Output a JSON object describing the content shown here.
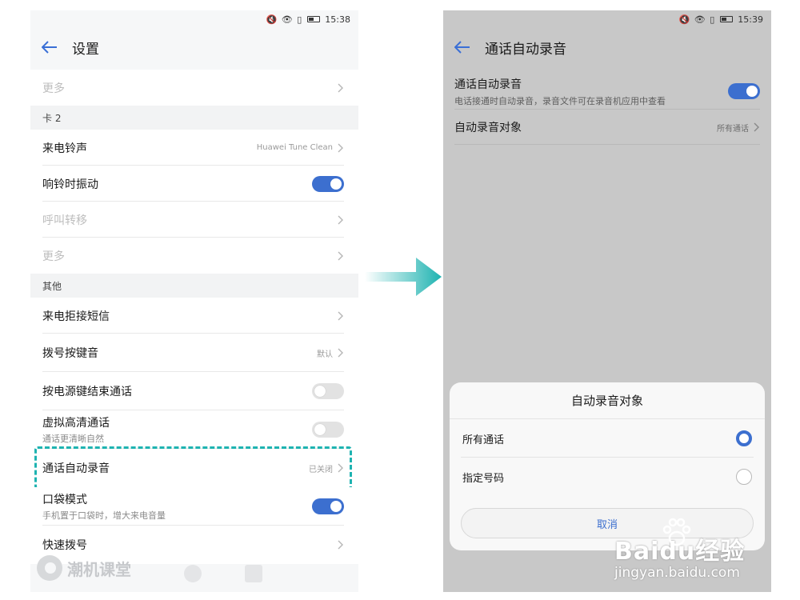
{
  "left": {
    "status": {
      "time": "15:38",
      "icons": "🔇 👁 ▯"
    },
    "title": "设置",
    "rows": [
      {
        "label": "更多",
        "disabled": true
      },
      {
        "section": "卡 2"
      },
      {
        "label": "来电铃声",
        "value": "Huawei Tune Clean"
      },
      {
        "label": "响铃时振动",
        "toggle": "on"
      },
      {
        "label": "呼叫转移",
        "disabled": true
      },
      {
        "label": "更多",
        "disabled": true
      },
      {
        "section": "其他"
      },
      {
        "label": "来电拒接短信"
      },
      {
        "label": "拨号按键音",
        "value": "默认"
      },
      {
        "label": "按电源键结束通话",
        "toggle": "off"
      },
      {
        "label": "虚拟高清通话",
        "sub": "通话更清晰自然",
        "toggle": "off"
      },
      {
        "label": "通话自动录音",
        "value": "已关闭",
        "highlighted": true
      },
      {
        "label": "口袋模式",
        "sub": "手机置于口袋时，增大来电音量",
        "toggle": "on"
      },
      {
        "label": "快速拨号"
      }
    ],
    "watermark": "潮机课堂"
  },
  "right": {
    "status": {
      "time": "15:39",
      "icons": "🔇 👁 ▯"
    },
    "title": "通话自动录音",
    "auto_record": {
      "label": "通话自动录音",
      "sub": "电话接通时自动录音，录音文件可在录音机应用中查看",
      "toggle": "on"
    },
    "target": {
      "label": "自动录音对象",
      "value": "所有通话"
    },
    "dialog": {
      "title": "自动录音对象",
      "options": [
        {
          "label": "所有通话",
          "checked": true
        },
        {
          "label": "指定号码",
          "checked": false
        }
      ],
      "cancel": "取消"
    }
  },
  "watermark_right": {
    "brand": "Baidu经验",
    "url": "jingyan.baidu.com"
  },
  "colors": {
    "accent": "#3c6fcf",
    "highlight": "#1eb3b1",
    "arrow": "#1eb3b1"
  }
}
